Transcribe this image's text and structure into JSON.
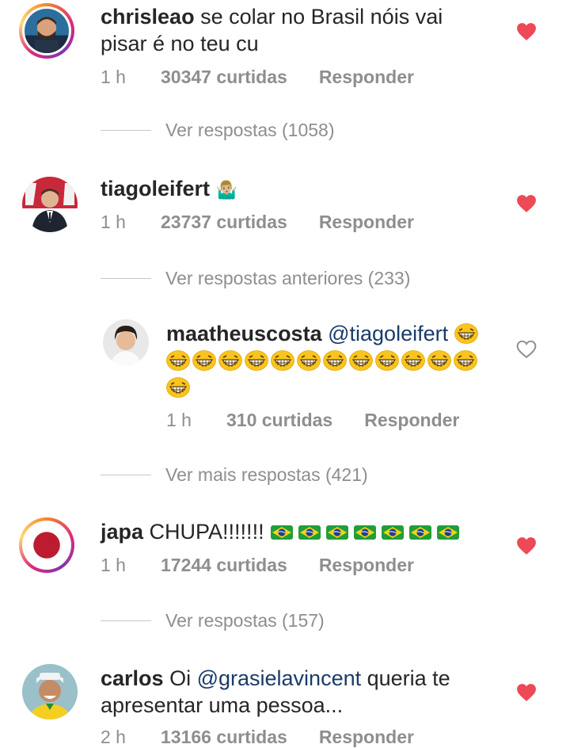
{
  "comments": [
    {
      "username": "chrisleao",
      "text": "se colar no Brasil nóis vai",
      "text2": "pisar é no teu cu",
      "time": "1 h",
      "likes": "30347 curtidas",
      "reply_label": "Responder",
      "liked": true,
      "view_replies": "Ver respostas (1058)"
    },
    {
      "username": "tiagoleifert",
      "text": "🤷🏼‍♂️",
      "time": "1 h",
      "likes": "23737 curtidas",
      "reply_label": "Responder",
      "liked": true,
      "view_replies": "Ver respostas anteriores (233)"
    },
    {
      "username": "maatheuscosta",
      "mention": "@tiagoleifert",
      "emoji_count": 14,
      "emoji_name": "grinning-squinting-face",
      "time": "1 h",
      "likes": "310 curtidas",
      "reply_label": "Responder",
      "liked": false,
      "view_replies": "Ver mais respostas (421)"
    },
    {
      "username": "japa",
      "text": "CHUPA!!!!!!!",
      "flag_count": 7,
      "flag_name": "brazil-flag",
      "time": "1 h",
      "likes": "17244 curtidas",
      "reply_label": "Responder",
      "liked": true,
      "view_replies": "Ver respostas (157)"
    },
    {
      "username": "carlos",
      "text": "Oi",
      "mention": "@grasielavincent",
      "text_after": "queria te",
      "text2": "apresentar uma pessoa...",
      "time": "2 h",
      "likes": "13166 curtidas",
      "reply_label": "Responder",
      "liked": true
    }
  ],
  "colors": {
    "text": "#262626",
    "meta": "#8e8e8e",
    "mention": "#1a3b68",
    "heart_liked": "#ed4956",
    "heart_outline": "#8e8e8e"
  }
}
